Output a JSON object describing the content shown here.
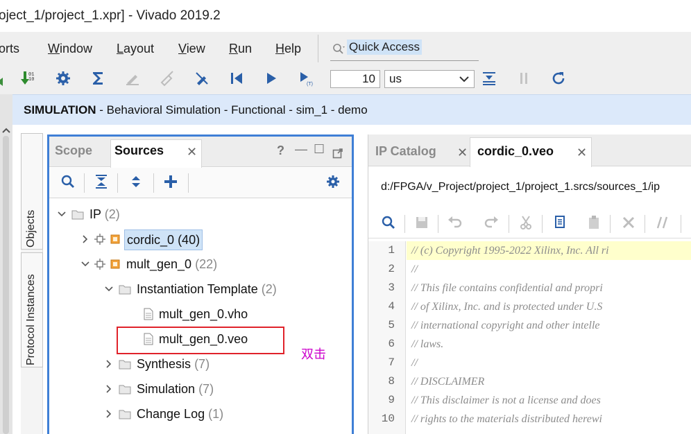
{
  "window": {
    "title": "oject_1/project_1.xpr] - Vivado 2019.2"
  },
  "menu": {
    "items": [
      {
        "label": "orts",
        "underline": "",
        "rest": "orts"
      },
      {
        "label": "Window",
        "underline": "W",
        "rest": "indow"
      },
      {
        "label": "Layout",
        "underline": "L",
        "rest": "ayout"
      },
      {
        "label": "View",
        "underline": "V",
        "rest": "iew"
      },
      {
        "label": "Run",
        "underline": "R",
        "rest": "un"
      },
      {
        "label": "Help",
        "underline": "H",
        "rest": "elp"
      }
    ],
    "quick_access": "Quick Access"
  },
  "toolbar": {
    "run_time_value": "10",
    "run_time_unit": "us"
  },
  "banner": {
    "bold": "SIMULATION",
    "rest": " - Behavioral Simulation - Functional - sim_1 - demo"
  },
  "vertical_tabs": {
    "objects": "Objects",
    "protocol": "Protocol Instances"
  },
  "sources_panel": {
    "tabs": {
      "scope": "Scope",
      "sources": "Sources"
    },
    "controls": {
      "help": "?",
      "minimize": "—",
      "maximize": "☐"
    },
    "tree": [
      {
        "label": "IP",
        "count": "(2)"
      },
      {
        "label": "cordic_0",
        "count": "(40)"
      },
      {
        "label": "mult_gen_0",
        "count": "(22)"
      },
      {
        "label": "Instantiation Template",
        "count": "(2)"
      },
      {
        "label": "mult_gen_0.vho",
        "count": ""
      },
      {
        "label": "mult_gen_0.veo",
        "count": ""
      },
      {
        "label": "Synthesis",
        "count": "(7)"
      },
      {
        "label": "Simulation",
        "count": "(7)"
      },
      {
        "label": "Change Log",
        "count": "(1)"
      }
    ]
  },
  "annotation": "双击",
  "editor": {
    "tabs": {
      "ip_catalog": "IP Catalog",
      "file": "cordic_0.veo"
    },
    "path": "d:/FPGA/v_Project/project_1/project_1.srcs/sources_1/ip",
    "lines": [
      {
        "n": "1",
        "text": "// (c) Copyright 1995-2022 Xilinx, Inc. All ri"
      },
      {
        "n": "2",
        "text": "//"
      },
      {
        "n": "3",
        "text": "// This file contains confidential and propri"
      },
      {
        "n": "4",
        "text": "// of Xilinx, Inc. and is protected under U.S"
      },
      {
        "n": "5",
        "text": "// international copyright and other intelle"
      },
      {
        "n": "6",
        "text": "// laws."
      },
      {
        "n": "7",
        "text": "//"
      },
      {
        "n": "8",
        "text": "// DISCLAIMER"
      },
      {
        "n": "9",
        "text": "// This disclaimer is not a license and does"
      },
      {
        "n": "10",
        "text": "// rights to the materials distributed herewi"
      }
    ]
  },
  "colors": {
    "banner_bg": "#dce9fa",
    "panel_border": "#3f7fd6",
    "selection": "#cfe3f7",
    "annotation_box": "#e0222a",
    "annotation_text": "#cc00cc",
    "highlight_line": "#ffffcc"
  }
}
